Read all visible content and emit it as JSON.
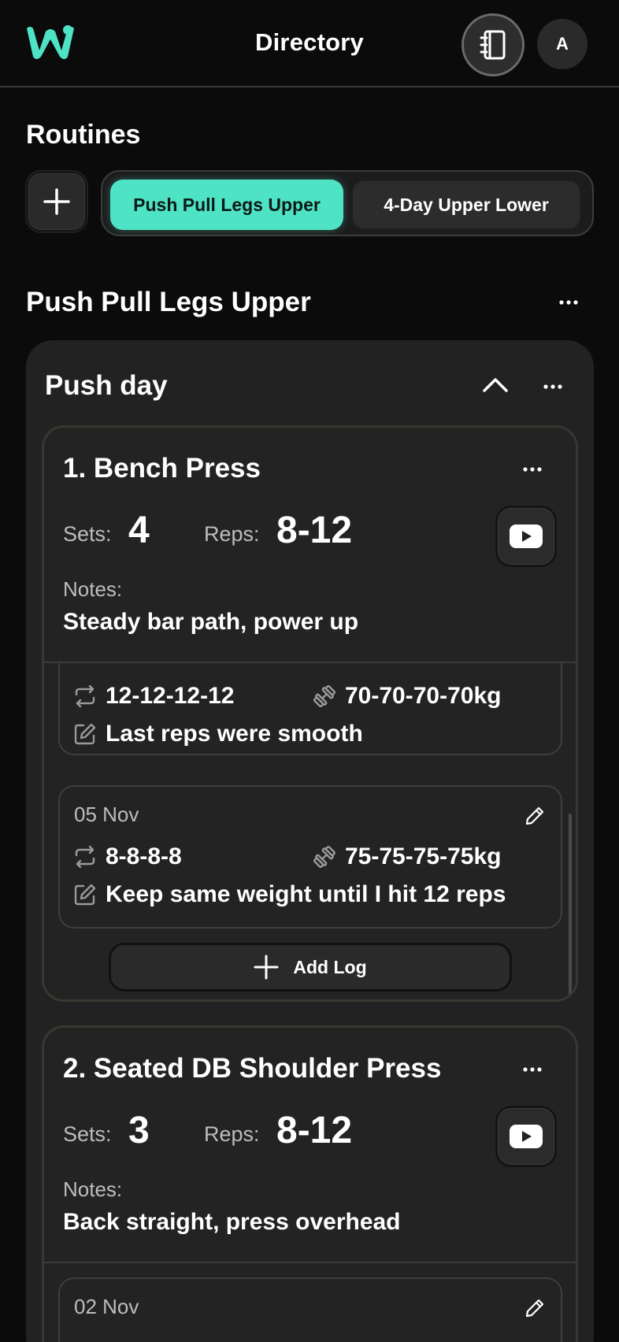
{
  "header": {
    "title": "Directory",
    "avatar_letter": "A",
    "icons": {
      "logo": "w-logo",
      "notebook": "notebook-icon"
    },
    "accent_color": "#4fe3c6"
  },
  "routines": {
    "title": "Routines",
    "tabs": [
      {
        "label": "Push Pull Legs Upper",
        "active": true
      },
      {
        "label": "4-Day Upper Lower",
        "active": false
      }
    ]
  },
  "selected_routine": {
    "name": "Push Pull Legs Upper",
    "day": {
      "title": "Push day",
      "expanded": true,
      "exercises": [
        {
          "title": "1. Bench Press",
          "sets_label": "Sets:",
          "sets": "4",
          "reps_label": "Reps:",
          "reps": "8-12",
          "notes_label": "Notes:",
          "notes": "Steady bar path, power up",
          "logs": [
            {
              "date": "",
              "reps": "12-12-12-12",
              "weight": "70-70-70-70kg",
              "note": "Last reps were smooth"
            },
            {
              "date": "05 Nov",
              "reps": "8-8-8-8",
              "weight": "75-75-75-75kg",
              "note": "Keep same weight until I hit 12 reps"
            }
          ],
          "add_log_label": "Add Log"
        },
        {
          "title": "2. Seated DB Shoulder Press",
          "sets_label": "Sets:",
          "sets": "3",
          "reps_label": "Reps:",
          "reps": "8-12",
          "notes_label": "Notes:",
          "notes": "Back straight, press overhead",
          "logs": [
            {
              "date": "02 Nov"
            }
          ]
        }
      ]
    }
  }
}
